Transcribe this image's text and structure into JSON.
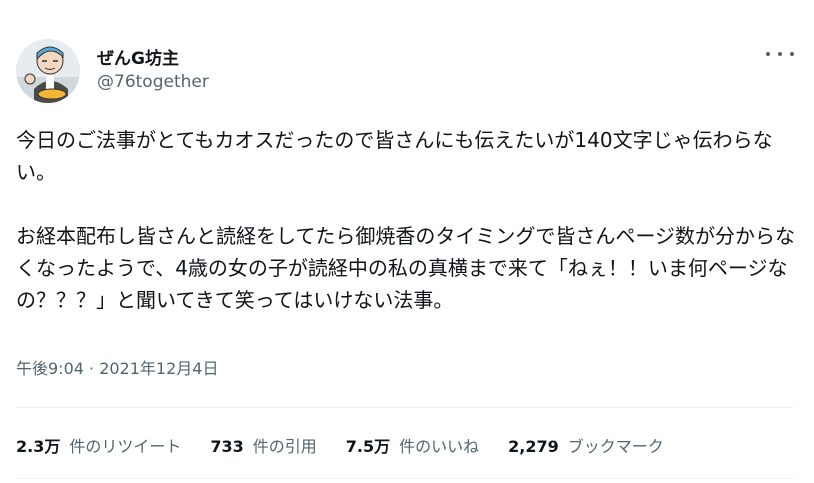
{
  "author": {
    "name": "ぜんG坊主",
    "handle": "@76together"
  },
  "tweet": {
    "paragraphs": [
      "今日のご法事がとてもカオスだったので皆さんにも伝えたいが140文字じゃ伝わらない。",
      "お経本配布し皆さんと読経をしてたら御焼香のタイミングで皆さんページ数が分からなくなったようで、4歳の女の子が読経中の私の真横まで来て「ねぇ！！いま何ページなの？？？」と聞いてきて笑ってはいけない法事。"
    ],
    "timestamp": "午後9:04 · 2021年12月4日"
  },
  "stats": [
    {
      "count": "2.3万",
      "label": "件のリツイート"
    },
    {
      "count": "733",
      "label": "件の引用"
    },
    {
      "count": "7.5万",
      "label": "件のいいね"
    },
    {
      "count": "2,279",
      "label": "ブックマーク"
    }
  ],
  "icons": {
    "more": "more-horizontal-icon",
    "avatar": "avatar-illustration"
  },
  "colors": {
    "text": "#0f1419",
    "secondary": "#536471",
    "divider": "#eff3f4"
  }
}
